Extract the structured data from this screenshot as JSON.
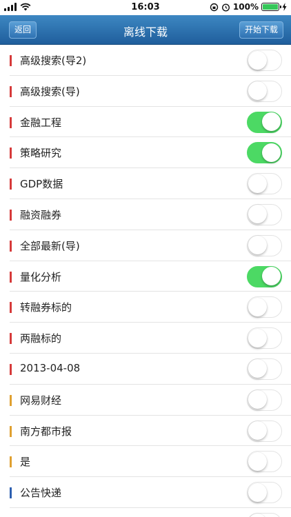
{
  "status_bar": {
    "time": "16:03",
    "battery_percent": "100%",
    "battery_level": 1.0,
    "signal_icon": "signal-bars-icon",
    "wifi_icon": "wifi-icon",
    "alarm_icon": "alarm-icon",
    "lock_icon": "orientation-lock-icon",
    "charging_icon": "charging-bolt-icon"
  },
  "nav": {
    "back_label": "返回",
    "title": "离线下载",
    "start_label": "开始下载"
  },
  "colors": {
    "red": "#d63a3a",
    "orange": "#e0a030",
    "blue": "#2d5fb0",
    "toggle_on": "#4cd964",
    "nav_top": "#3d87c2",
    "nav_bottom": "#1f5e9c"
  },
  "items": [
    {
      "label": "高级搜索(导2)",
      "marker": "red",
      "enabled": false
    },
    {
      "label": "高级搜索(导)",
      "marker": "red",
      "enabled": false
    },
    {
      "label": "金融工程",
      "marker": "red",
      "enabled": true
    },
    {
      "label": "策略研究",
      "marker": "red",
      "enabled": true
    },
    {
      "label": "GDP数据",
      "marker": "red",
      "enabled": false
    },
    {
      "label": "融资融券",
      "marker": "red",
      "enabled": false
    },
    {
      "label": "全部最新(导)",
      "marker": "red",
      "enabled": false
    },
    {
      "label": "量化分析",
      "marker": "red",
      "enabled": true
    },
    {
      "label": "转融券标的",
      "marker": "red",
      "enabled": false
    },
    {
      "label": "两融标的",
      "marker": "red",
      "enabled": false
    },
    {
      "label": "2013-04-08",
      "marker": "red",
      "enabled": false
    },
    {
      "label": "网易财经",
      "marker": "orange",
      "enabled": false
    },
    {
      "label": "南方都市报",
      "marker": "orange",
      "enabled": false
    },
    {
      "label": "是",
      "marker": "orange",
      "enabled": false
    },
    {
      "label": "公告快递",
      "marker": "blue",
      "enabled": false
    },
    {
      "label": "",
      "marker": "",
      "enabled": false
    }
  ]
}
